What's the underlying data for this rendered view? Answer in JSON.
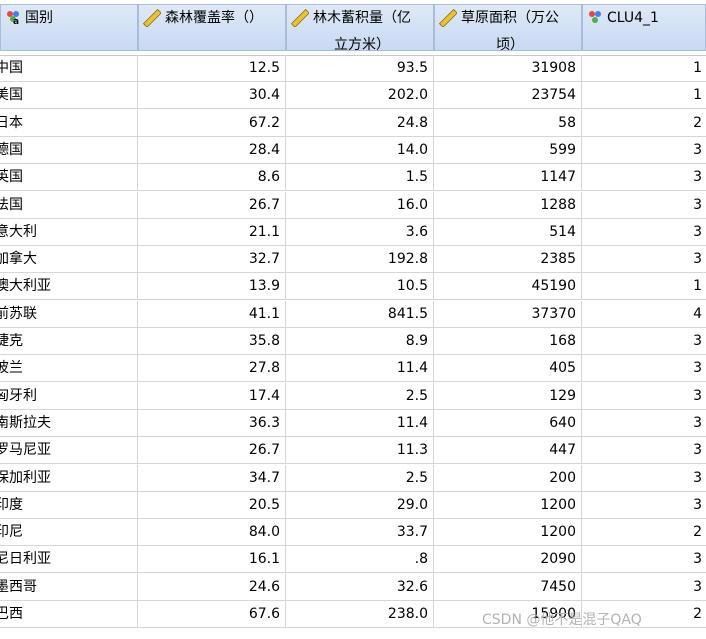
{
  "columns": [
    {
      "label_line1": "国别",
      "label_line2": "",
      "icon": "nominal-string-icon"
    },
    {
      "label_line1": "森林覆盖率（）",
      "label_line2": "",
      "icon": "scale-ruler-icon"
    },
    {
      "label_line1": "林木蓄积量（亿",
      "label_line2": "立方米）",
      "icon": "scale-ruler-icon"
    },
    {
      "label_line1": "草原面积（万公",
      "label_line2": "顷）",
      "icon": "scale-ruler-icon"
    },
    {
      "label_line1": "CLU4_1",
      "label_line2": "",
      "icon": "nominal-icon"
    }
  ],
  "rows": [
    {
      "country": "中国",
      "forest": "12.5",
      "timber": "93.5",
      "grass": "31908",
      "clu": "1"
    },
    {
      "country": "美国",
      "forest": "30.4",
      "timber": "202.0",
      "grass": "23754",
      "clu": "1"
    },
    {
      "country": "日本",
      "forest": "67.2",
      "timber": "24.8",
      "grass": "58",
      "clu": "2"
    },
    {
      "country": "德国",
      "forest": "28.4",
      "timber": "14.0",
      "grass": "599",
      "clu": "3"
    },
    {
      "country": "英国",
      "forest": "8.6",
      "timber": "1.5",
      "grass": "1147",
      "clu": "3"
    },
    {
      "country": "法国",
      "forest": "26.7",
      "timber": "16.0",
      "grass": "1288",
      "clu": "3"
    },
    {
      "country": "意大利",
      "forest": "21.1",
      "timber": "3.6",
      "grass": "514",
      "clu": "3"
    },
    {
      "country": "加拿大",
      "forest": "32.7",
      "timber": "192.8",
      "grass": "2385",
      "clu": "3"
    },
    {
      "country": "澳大利亚",
      "forest": "13.9",
      "timber": "10.5",
      "grass": "45190",
      "clu": "1"
    },
    {
      "country": "前苏联",
      "forest": "41.1",
      "timber": "841.5",
      "grass": "37370",
      "clu": "4"
    },
    {
      "country": "捷克",
      "forest": "35.8",
      "timber": "8.9",
      "grass": "168",
      "clu": "3"
    },
    {
      "country": "波兰",
      "forest": "27.8",
      "timber": "11.4",
      "grass": "405",
      "clu": "3"
    },
    {
      "country": "匈牙利",
      "forest": "17.4",
      "timber": "2.5",
      "grass": "129",
      "clu": "3"
    },
    {
      "country": "南斯拉夫",
      "forest": "36.3",
      "timber": "11.4",
      "grass": "640",
      "clu": "3"
    },
    {
      "country": "罗马尼亚",
      "forest": "26.7",
      "timber": "11.3",
      "grass": "447",
      "clu": "3"
    },
    {
      "country": "保加利亚",
      "forest": "34.7",
      "timber": "2.5",
      "grass": "200",
      "clu": "3"
    },
    {
      "country": "印度",
      "forest": "20.5",
      "timber": "29.0",
      "grass": "1200",
      "clu": "3"
    },
    {
      "country": "印尼",
      "forest": "84.0",
      "timber": "33.7",
      "grass": "1200",
      "clu": "2"
    },
    {
      "country": "尼日利亚",
      "forest": "16.1",
      "timber": ".8",
      "grass": "2090",
      "clu": "3"
    },
    {
      "country": "墨西哥",
      "forest": "24.6",
      "timber": "32.6",
      "grass": "7450",
      "clu": "3"
    },
    {
      "country": "巴西",
      "forest": "67.6",
      "timber": "238.0",
      "grass": "15900",
      "clu": "2"
    }
  ],
  "watermark": "CSDN @他不是混子QAQ"
}
